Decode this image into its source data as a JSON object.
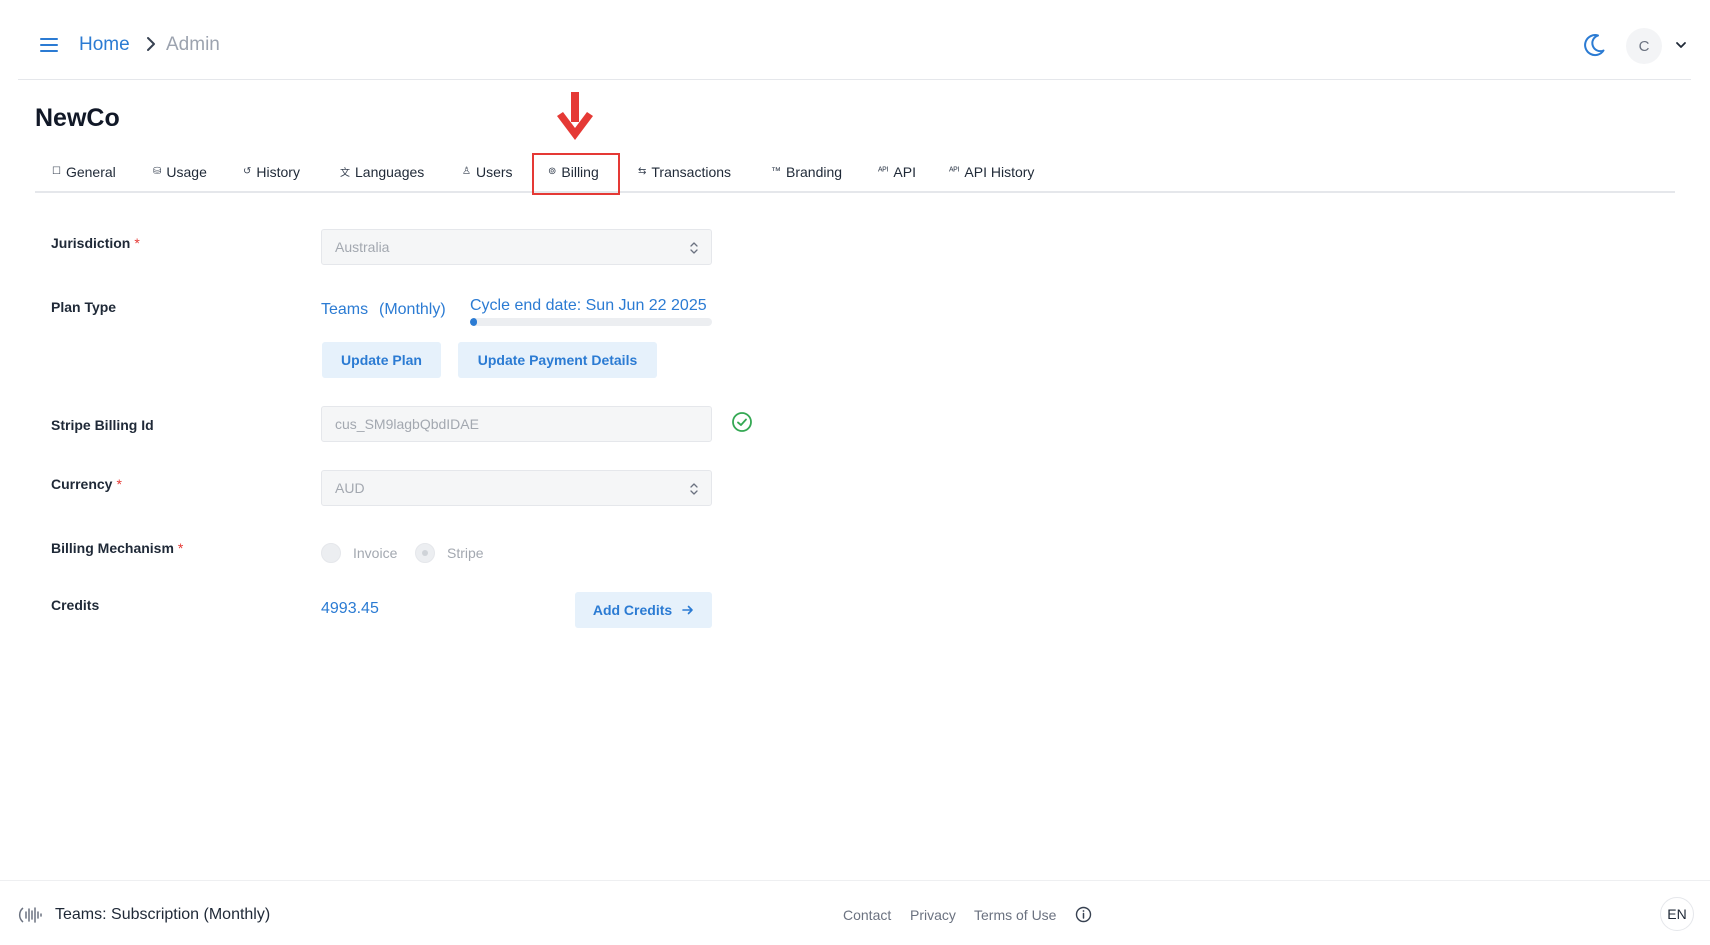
{
  "header": {
    "breadcrumb": {
      "home": "Home",
      "current": "Admin"
    },
    "user_initial": "C",
    "colors": {
      "accent": "#2b7bd3"
    }
  },
  "org": {
    "title": "NewCo"
  },
  "tabs": [
    {
      "label": "General",
      "icon": "square-icon",
      "glyph": "☐"
    },
    {
      "label": "Usage",
      "icon": "database-icon",
      "glyph": "⛁"
    },
    {
      "label": "History",
      "icon": "history-icon",
      "glyph": "↺"
    },
    {
      "label": "Languages",
      "icon": "translate-icon",
      "glyph": "文"
    },
    {
      "label": "Users",
      "icon": "user-icon",
      "glyph": "♙"
    },
    {
      "label": "Billing",
      "icon": "coins-icon",
      "glyph": "⊚",
      "active": true
    },
    {
      "label": "Transactions",
      "icon": "transfer-icon",
      "glyph": "⇆"
    },
    {
      "label": "Branding",
      "icon": "trademark-icon",
      "glyph": "™"
    },
    {
      "label": "API",
      "icon": "api-icon",
      "glyph": "ᴬᴾᴵ"
    },
    {
      "label": "API History",
      "icon": "api-history-icon",
      "glyph": "ᴬᴾᴵ"
    }
  ],
  "form": {
    "jurisdiction": {
      "label": "Jurisdiction",
      "required_mark": "*",
      "value": "Australia"
    },
    "plan_type": {
      "label": "Plan Type",
      "plan": "Teams",
      "period": "(Monthly)",
      "cycle_end": "Cycle end date: Sun Jun 22 2025",
      "cycle_progress": 0.03,
      "update_plan_label": "Update Plan",
      "update_payment_label": "Update Payment Details"
    },
    "stripe_billing_id": {
      "label": "Stripe Billing Id",
      "value": "cus_SM9lagbQbdIDAE",
      "verified": true
    },
    "currency": {
      "label": "Currency",
      "required_mark": "*",
      "value": "AUD"
    },
    "billing_mechanism": {
      "label": "Billing Mechanism",
      "required_mark": "*",
      "options": [
        "Invoice",
        "Stripe"
      ],
      "selected": "Stripe"
    },
    "credits": {
      "label": "Credits",
      "value": "4993.45",
      "add_label": "Add Credits"
    }
  },
  "footer": {
    "subscription": "Teams: Subscription (Monthly)",
    "links": [
      "Contact",
      "Privacy",
      "Terms of Use"
    ],
    "language": "EN"
  }
}
